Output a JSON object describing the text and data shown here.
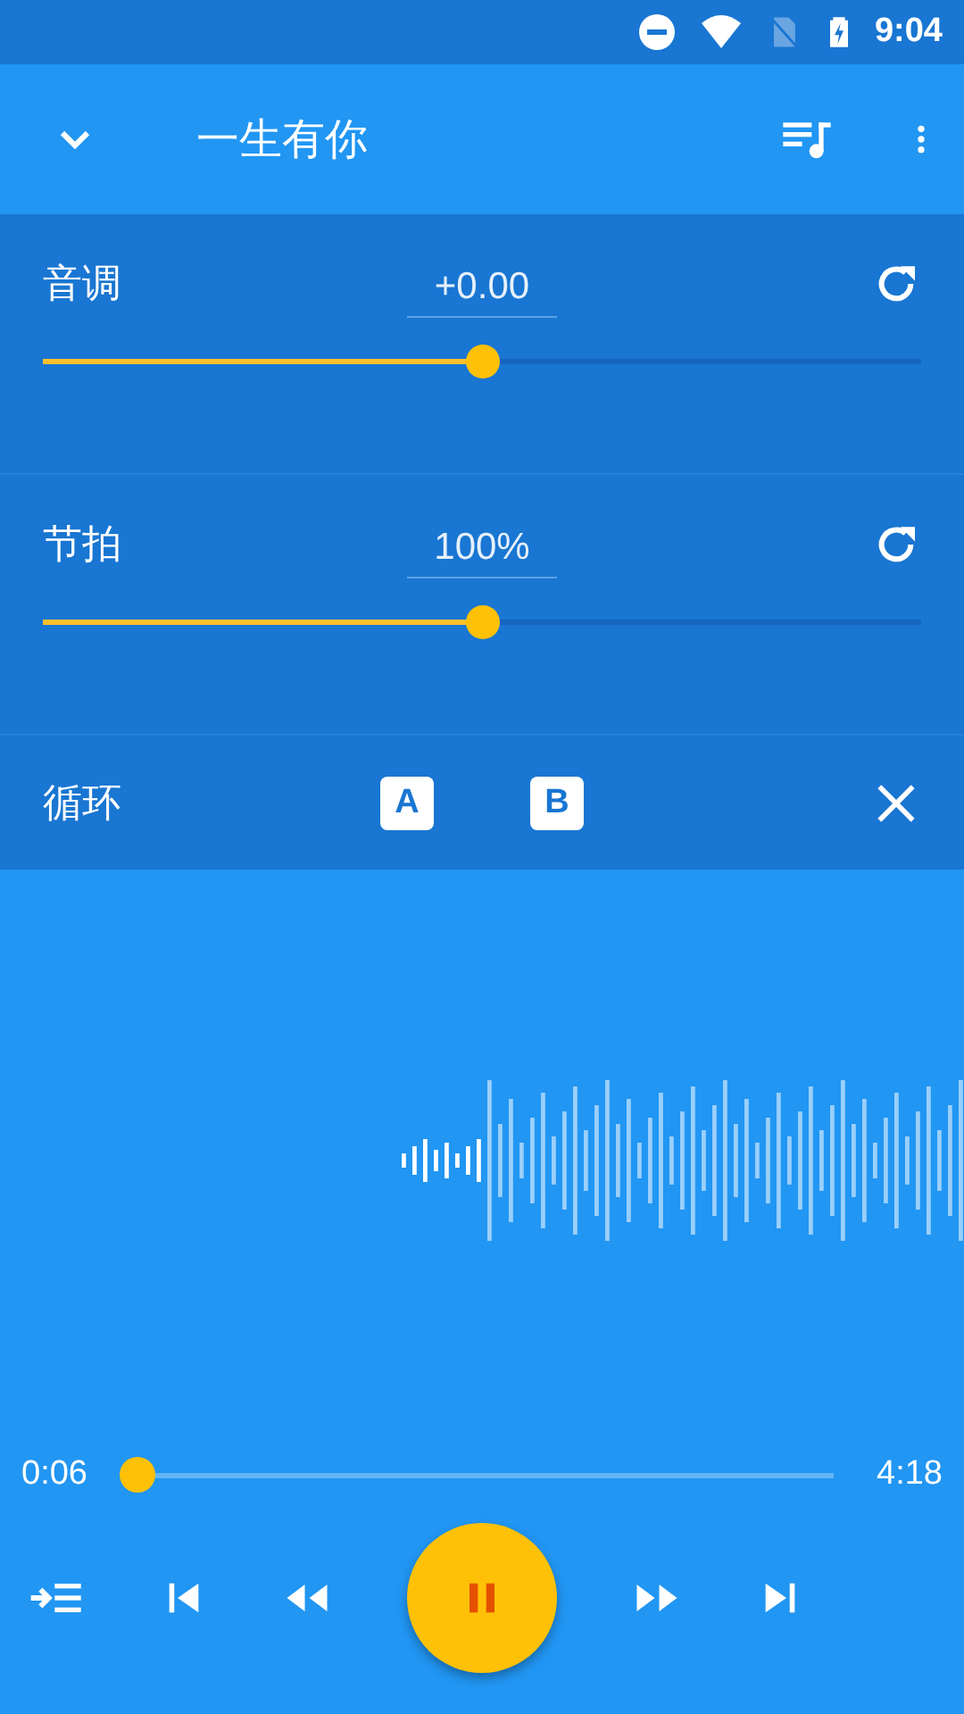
{
  "status_bar": {
    "time": "9:04"
  },
  "app_bar": {
    "title": "一生有你"
  },
  "adjusters": [
    {
      "label": "音调",
      "value": "+0.00",
      "level": 0.5
    },
    {
      "label": "节拍",
      "value": "100%",
      "level": 0.5
    }
  ],
  "loop": {
    "label": "循环",
    "point_a": "A",
    "point_b": "B"
  },
  "progress": {
    "elapsed": "0:06",
    "total": "4:18",
    "level": 0.0
  },
  "player": {
    "playing": true
  }
}
